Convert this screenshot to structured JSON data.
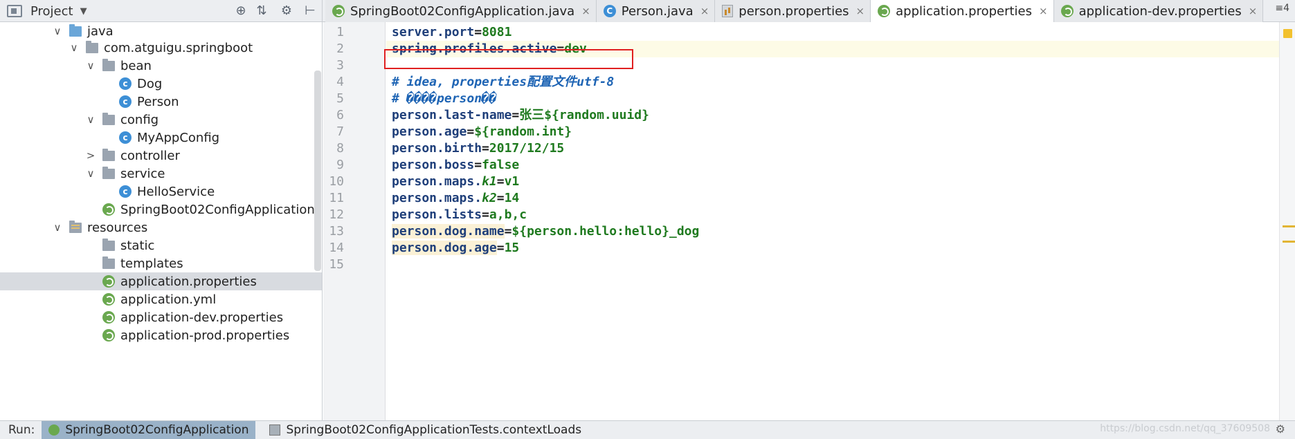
{
  "project_panel": {
    "title": "Project",
    "caret": "▼",
    "tools": [
      "⊕",
      "⇅",
      "⚙",
      "⊢"
    ]
  },
  "editor_tabs": [
    {
      "label": "SpringBoot02ConfigApplication.java",
      "icon": "spring-icon",
      "close": "×"
    },
    {
      "label": "Person.java",
      "icon": "class-icon",
      "close": "×"
    },
    {
      "label": "person.properties",
      "icon": "properties-icon",
      "close": "×"
    },
    {
      "label": "application.properties",
      "icon": "spring-icon",
      "close": "×",
      "active": true
    },
    {
      "label": "application-dev.properties",
      "icon": "spring-icon",
      "close": "×"
    }
  ],
  "tab_overflow": "≡4",
  "tree": {
    "items": [
      {
        "label": "java",
        "arrow": "∨",
        "icon": "folder-icon"
      },
      {
        "label": "com.atguigu.springboot",
        "arrow": "∨",
        "icon": "package-icon"
      },
      {
        "label": "bean",
        "arrow": "∨",
        "icon": "package-icon"
      },
      {
        "label": "Dog",
        "arrow": "",
        "icon": "class-icon",
        "icon_glyph": "c"
      },
      {
        "label": "Person",
        "arrow": "",
        "icon": "class-icon",
        "icon_glyph": "c"
      },
      {
        "label": "config",
        "arrow": "∨",
        "icon": "package-icon"
      },
      {
        "label": "MyAppConfig",
        "arrow": "",
        "icon": "class-icon",
        "icon_glyph": "c"
      },
      {
        "label": "controller",
        "arrow": ">",
        "icon": "package-icon"
      },
      {
        "label": "service",
        "arrow": "∨",
        "icon": "package-icon"
      },
      {
        "label": "HelloService",
        "arrow": "",
        "icon": "class-icon",
        "icon_glyph": "c"
      },
      {
        "label": "SpringBoot02ConfigApplication",
        "arrow": "",
        "icon": "spring-icon"
      },
      {
        "label": "resources",
        "arrow": "∨",
        "icon": "resources-folder-icon"
      },
      {
        "label": "static",
        "arrow": "",
        "icon": "folder-icon"
      },
      {
        "label": "templates",
        "arrow": "",
        "icon": "folder-icon"
      },
      {
        "label": "application.properties",
        "arrow": "",
        "icon": "spring-icon",
        "selected": true
      },
      {
        "label": "application.yml",
        "arrow": "",
        "icon": "spring-icon"
      },
      {
        "label": "application-dev.properties",
        "arrow": "",
        "icon": "spring-icon"
      },
      {
        "label": "application-prod.properties",
        "arrow": "",
        "icon": "spring-icon"
      }
    ]
  },
  "code": {
    "line_numbers": [
      "1",
      "2",
      "3",
      "4",
      "5",
      "6",
      "7",
      "8",
      "9",
      "10",
      "11",
      "12",
      "13",
      "14",
      "15"
    ],
    "lines": [
      {
        "key": "server.port",
        "eq": "=",
        "value": "8081"
      },
      {
        "key": "spring.profiles.active",
        "eq": "=",
        "value": "dev",
        "highlighted": true
      },
      {
        "text": ""
      },
      {
        "comment": "# idea, properties配置文件utf-8"
      },
      {
        "comment": "# ����person��"
      },
      {
        "key": "person.last-name",
        "eq": "=",
        "value": "张三${random.uuid}"
      },
      {
        "key": "person.age",
        "eq": "=",
        "value": "${random.int}"
      },
      {
        "key": "person.birth",
        "eq": "=",
        "value": "2017/12/15"
      },
      {
        "key": "person.boss",
        "eq": "=",
        "value": "false"
      },
      {
        "key": "person.maps.",
        "subkey": "k1",
        "eq": "=",
        "value": "v1"
      },
      {
        "key": "person.maps.",
        "subkey": "k2",
        "eq": "=",
        "value": "14"
      },
      {
        "key": "person.lists",
        "eq": "=",
        "value": "a,b,c"
      },
      {
        "key": "person.dog.name",
        "eq": "=",
        "value": "${person.hello:hello}_dog"
      },
      {
        "key": "person.dog.age",
        "eq": "=",
        "value": "15"
      },
      {
        "text": ""
      }
    ]
  },
  "runbar": {
    "label": "Run:",
    "tabs": [
      "SpringBoot02ConfigApplication",
      "SpringBoot02ConfigApplicationTests.contextLoads"
    ]
  },
  "watermark": "https://blog.csdn.net/qq_37609508",
  "colors": {
    "highlight_box": "#e02020",
    "key": "#1f3f7a",
    "value": "#1f7a1f",
    "comment": "#1e64b4"
  }
}
